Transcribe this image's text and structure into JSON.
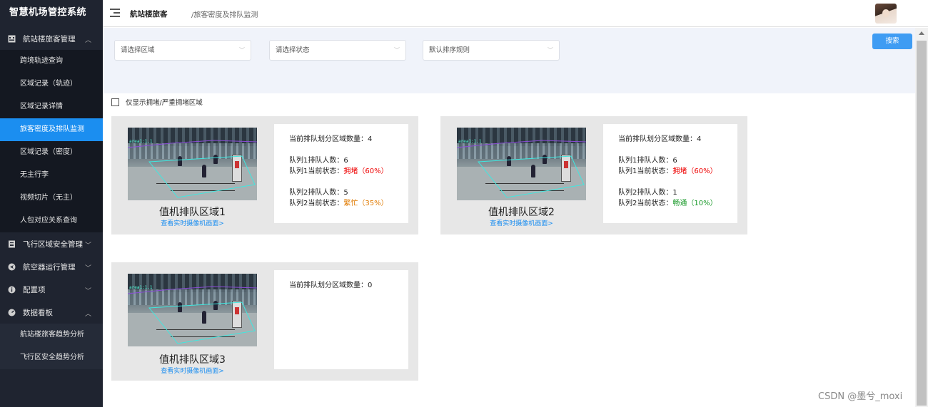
{
  "app": {
    "title": "智慧机场管控系统"
  },
  "sidebar": {
    "groups": [
      {
        "label": "航站楼旅客管理",
        "expanded": true,
        "items": [
          "跨境轨迹查询",
          "区域记录（轨迹）",
          "区域记录详情",
          "旅客密度及排队监测",
          "区域记录（密度）",
          "无主行李",
          "视频切片（无主）",
          "人包对应关系查询"
        ],
        "active_index": 3
      },
      {
        "label": "飞行区域安全管理",
        "expanded": false
      },
      {
        "label": "航空器运行管理",
        "expanded": false
      },
      {
        "label": "配置项",
        "expanded": false
      },
      {
        "label": "数据看板",
        "expanded": true,
        "items": [
          "航站楼旅客趋势分析",
          "飞行区安全趋势分析"
        ]
      }
    ]
  },
  "header": {
    "breadcrumb_1": "航站楼旅客",
    "breadcrumb_2": "/旅客密度及排队监测"
  },
  "filters": {
    "area_placeholder": "请选择区域",
    "status_placeholder": "请选择状态",
    "sort_value": "默认排序规则",
    "search_label": "搜索",
    "congested_only_label": "仅显示拥堵/严重拥堵区域"
  },
  "cards": [
    {
      "name": "值机排队区域1",
      "link": "查看实时摄像机画面>",
      "cam_label": "area1:1.1",
      "zone_count_label": "当前排队划分区域数量：",
      "zone_count": "4",
      "q1_count_label": "队列1排队人数：",
      "q1_count": "6",
      "q1_status_label": "队列1当前状态：",
      "q1_status": "拥堵（60%）",
      "q2_count_label": "队列2排队人数：",
      "q2_count": "5",
      "q2_status_label": "队列2当前状态：",
      "q2_status": "繁忙（35%）"
    },
    {
      "name": "值机排队区域2",
      "link": "查看实时摄像机画面>",
      "cam_label": "area1:1.1",
      "zone_count_label": "当前排队划分区域数量：",
      "zone_count": "4",
      "q1_count_label": "队列1排队人数：",
      "q1_count": "6",
      "q1_status_label": "队列1当前状态：",
      "q1_status": "拥堵（60%）",
      "q2_count_label": "队列2排队人数：",
      "q2_count": "1",
      "q2_status_label": "队列2当前状态：",
      "q2_status": "畅通（10%）"
    },
    {
      "name": "值机排队区域3",
      "link": "查看实时摄像机画面>",
      "cam_label": "area1:1.1",
      "zone_count_label": "当前排队划分区域数量：",
      "zone_count": "0"
    }
  ],
  "status_colors": {
    "congested": "#e00000",
    "busy": "#e07a00",
    "smooth": "#1a9a2a",
    "accent": "#1b8ef0"
  },
  "watermark": "CSDN @墨兮_moxi"
}
